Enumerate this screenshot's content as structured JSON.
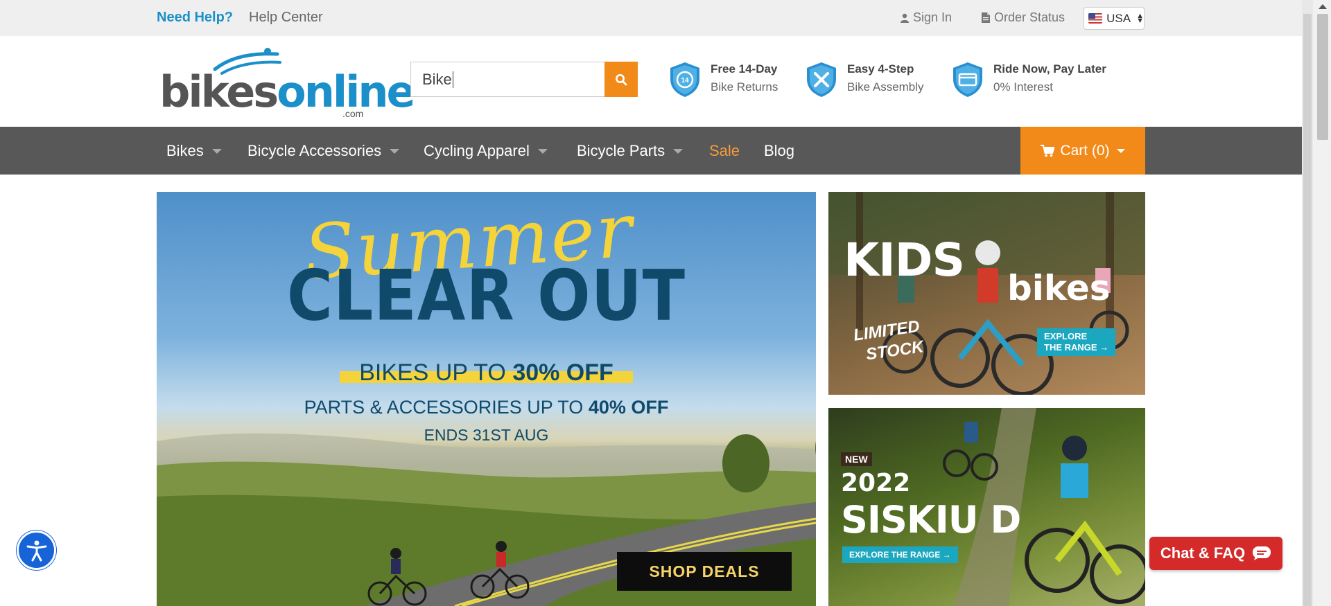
{
  "topbar": {
    "need_help": "Need Help?",
    "help_center": "Help Center",
    "sign_in": "Sign In",
    "order_status": "Order Status",
    "country": "USA"
  },
  "header": {
    "logo_text_a": "bikes",
    "logo_text_b": "online",
    "logo_com": ".com",
    "search": {
      "value": "Bike"
    },
    "usps": [
      {
        "title": "Free 14-Day",
        "subtitle": "Bike Returns",
        "icon": "returns-shield-icon"
      },
      {
        "title": "Easy 4-Step",
        "subtitle": "Bike Assembly",
        "icon": "tools-shield-icon"
      },
      {
        "title": "Ride Now, Pay Later",
        "subtitle": "0% Interest",
        "icon": "card-shield-icon"
      }
    ]
  },
  "nav": {
    "items": [
      {
        "label": "Bikes"
      },
      {
        "label": "Bicycle Accessories"
      },
      {
        "label": "Cycling Apparel"
      },
      {
        "label": "Bicycle Parts"
      },
      {
        "label": "Sale"
      },
      {
        "label": "Blog"
      }
    ],
    "cart": "Cart (0)"
  },
  "hero": {
    "script_title": "Summer",
    "title": "CLEAR OUT",
    "bikes_line_a": "BIKES UP TO ",
    "bikes_line_b": "30% OFF",
    "parts_line_a": "PARTS & ACCESSORIES UP TO ",
    "parts_line_b": "40% OFF",
    "ends": "ENDS 31ST AUG",
    "cta": "SHOP DEALS"
  },
  "promo_kids": {
    "title_a": "KIDS",
    "title_b": "bikes",
    "stamp_line1": "LIMITED",
    "stamp_line2": "STOCK",
    "cta_line1": "EXPLORE",
    "cta_line2": "THE RANGE →"
  },
  "promo_siskiu": {
    "badge": "NEW",
    "year": "2022",
    "title": "SISKIU D",
    "cta": "EXPLORE THE RANGE →"
  },
  "chat": {
    "label": "Chat & FAQ"
  },
  "colors": {
    "brand_blue": "#1a8fc9",
    "accent_orange": "#f28a1a",
    "nav_gray": "#585858",
    "chat_red": "#d42a2a"
  }
}
